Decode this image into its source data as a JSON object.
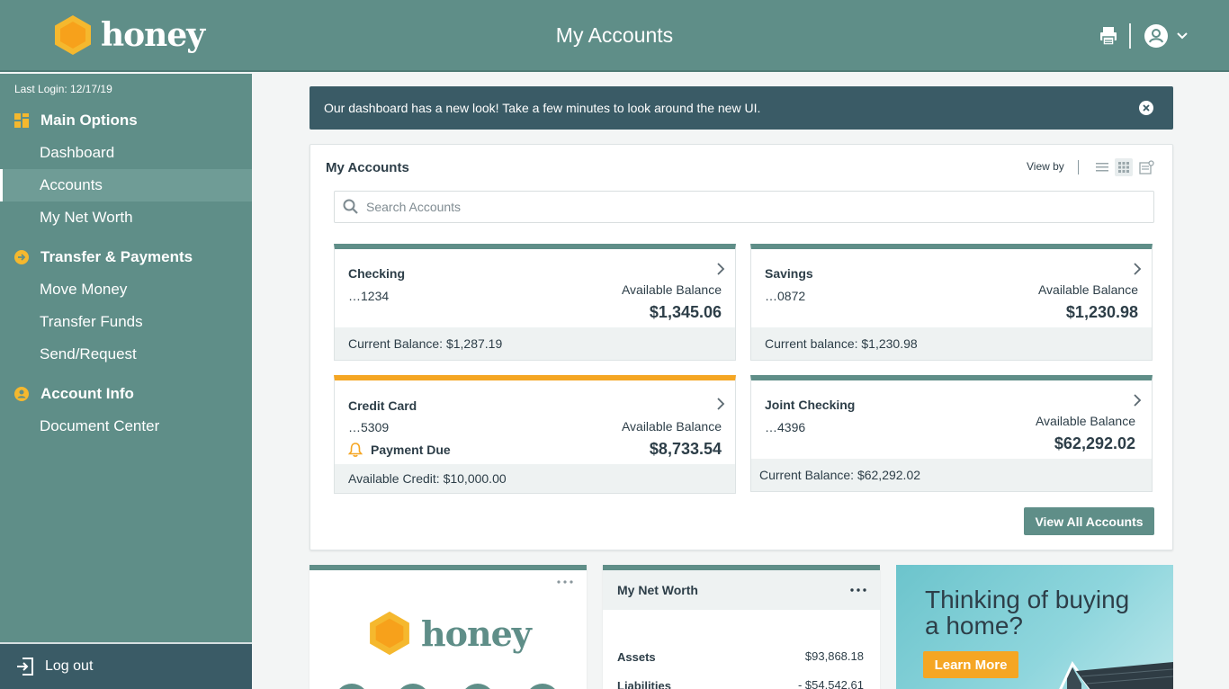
{
  "header": {
    "brand": "honey",
    "title": "My Accounts",
    "print_icon": "printer-icon",
    "user_icon": "user-icon"
  },
  "sidebar": {
    "last_login": "Last Login: 12/17/19",
    "sections": [
      {
        "label": "Main Options",
        "icon": "grid-icon",
        "items": [
          "Dashboard",
          "Accounts",
          "My Net Worth"
        ]
      },
      {
        "label": "Transfer & Payments",
        "icon": "arrow-circle-icon",
        "items": [
          "Move Money",
          "Transfer Funds",
          "Send/Request"
        ]
      },
      {
        "label": "Account Info",
        "icon": "user-circle-icon",
        "items": [
          "Document Center"
        ]
      }
    ],
    "active_item": "Accounts",
    "logout_label": "Log out"
  },
  "banner": {
    "text": "Our dashboard has a new look! Take a few minutes to look around the new UI."
  },
  "accounts_panel": {
    "title": "My Accounts",
    "view_by_label": "View by",
    "search_placeholder": "Search Accounts",
    "view_all_label": "View All Accounts",
    "accounts": [
      {
        "name": "Checking",
        "number": "…1234",
        "avail_label": "Available Balance",
        "avail_amount": "$1,345.06",
        "footer": "Current Balance: $1,287.19"
      },
      {
        "name": "Savings",
        "number": "…0872",
        "avail_label": "Available Balance",
        "avail_amount": "$1,230.98",
        "footer": "Current balance: $1,230.98"
      },
      {
        "name": "Credit Card",
        "number": "…5309",
        "avail_label": "Available Balance",
        "avail_amount": "$8,733.54",
        "status": "Payment Due",
        "footer": "Available Credit: $10,000.00"
      },
      {
        "name": "Joint Checking",
        "number": "…4396",
        "avail_label": "Available Balance",
        "avail_amount": "$62,292.02",
        "footer": "Current Balance: $62,292.02"
      }
    ]
  },
  "widgets": {
    "brand_widget": {
      "brand": "honey"
    },
    "net_worth": {
      "title": "My Net Worth",
      "rows": [
        {
          "label": "Assets",
          "value": "$93,868.18"
        },
        {
          "label": "Liabilities",
          "value": "- $54,542.61"
        }
      ]
    },
    "promo": {
      "text": "Thinking of buying a home?",
      "button": "Learn More"
    }
  },
  "colors": {
    "teal": "#5f8e88",
    "dark_teal": "#3a5b66",
    "accent_orange": "#f5a623"
  }
}
